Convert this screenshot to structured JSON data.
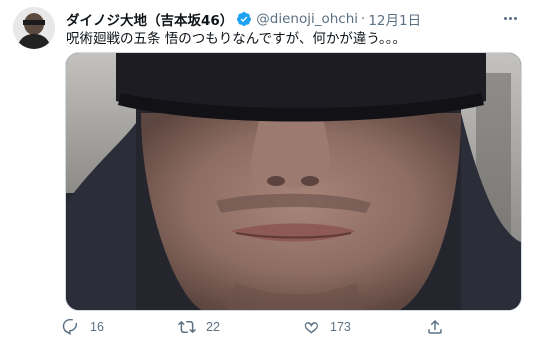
{
  "tweet": {
    "display_name": "ダイノジ大地（吉本坂46）",
    "handle": "@dienoji_ohchi",
    "separator": "·",
    "date": "12月1日",
    "text": "呪術廻戦の五条 悟のつもりなんですが、何かが違う。。。",
    "verified": true
  },
  "actions": {
    "reply_count": "16",
    "retweet_count": "22",
    "like_count": "173"
  },
  "icons": {
    "verified": "verified-badge-icon",
    "more": "more-icon",
    "reply": "reply-icon",
    "retweet": "retweet-icon",
    "like": "heart-icon",
    "share": "share-icon"
  },
  "colors": {
    "text": "#0f1419",
    "secondary": "#5b7083",
    "verified": "#1da1f2",
    "border": "#cfd9de"
  }
}
